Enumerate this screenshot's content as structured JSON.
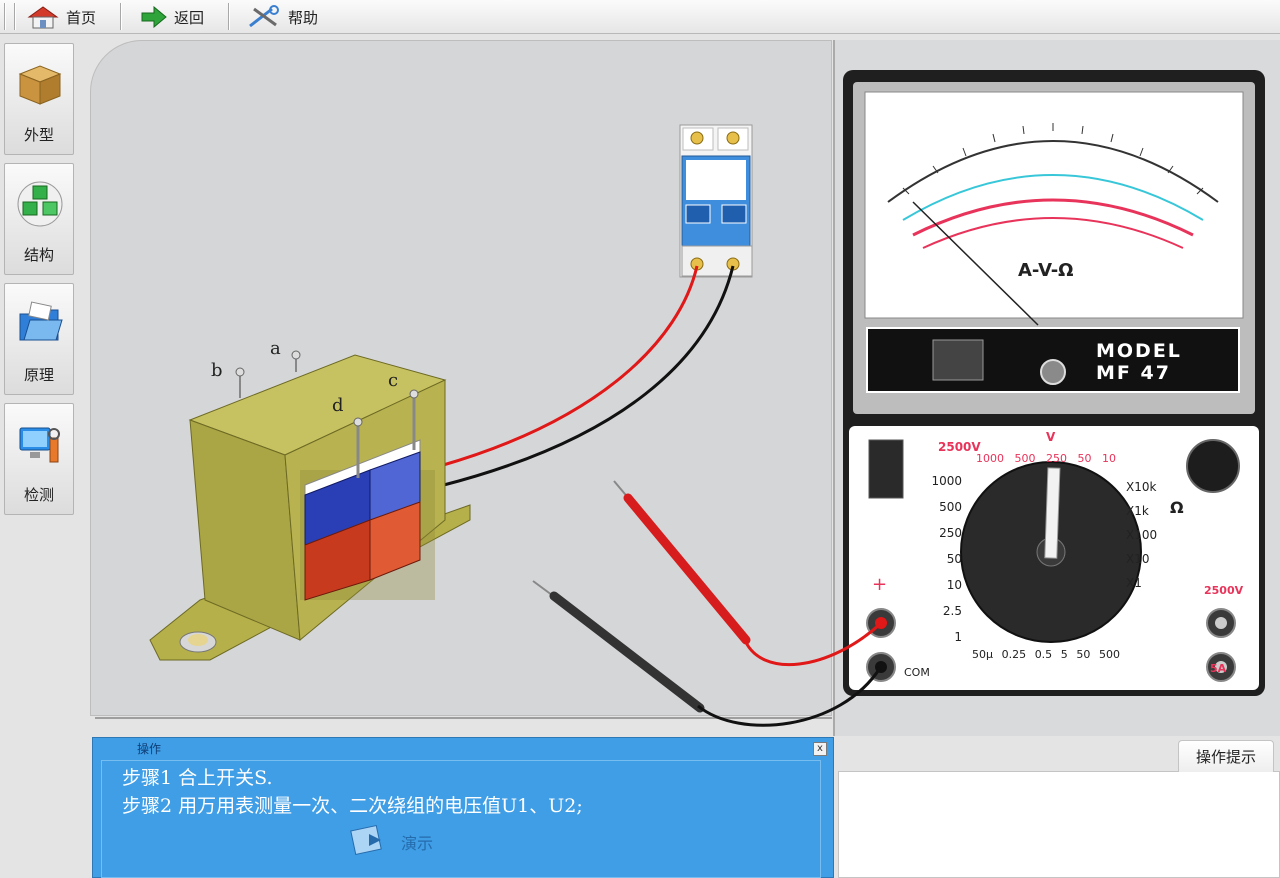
{
  "toolbar": {
    "home_label": "首页",
    "back_label": "返回",
    "help_label": "帮助"
  },
  "sidebar": {
    "items": [
      {
        "label": "外型"
      },
      {
        "label": "结构"
      },
      {
        "label": "原理"
      },
      {
        "label": "检测"
      }
    ]
  },
  "transformer": {
    "terminals": {
      "a": "a",
      "b": "b",
      "c": "c",
      "d": "d"
    }
  },
  "multimeter": {
    "model_line1": "MODEL",
    "model_line2": "MF 47",
    "scale_symbol": "A-V-Ω",
    "plus_label": "+",
    "com_label": "COM",
    "dial_labels_left": [
      "1000",
      "500",
      "250",
      "50",
      "10",
      "2.5",
      "1"
    ],
    "dial_labels_top": [
      "1000",
      "500",
      "250",
      "50",
      "10"
    ],
    "dial_labels_right": [
      "X10k",
      "X1k",
      "X100",
      "X10",
      "X1"
    ],
    "dial_labels_bottom": [
      "50μ",
      "0.25",
      "0.5",
      "5",
      "50",
      "500"
    ],
    "side_labels": {
      "v": "V",
      "ohm": "Ω",
      "top_red": "2500V",
      "right_red": "2500V",
      "right_bottom": "5A"
    },
    "colors": {
      "body": "#1f1f1f",
      "dial_face": "#ffffff",
      "red_scale": "#e8345a",
      "cyan_scale": "#38c7d8"
    }
  },
  "steps": {
    "tab_label": "操作",
    "step1": "步骤1  合上开关S.",
    "step2": "步骤2  用万用表测量一次、二次绕组的电压值U1、U2;",
    "demo_label": "演示",
    "close_label": "x"
  },
  "tips": {
    "tab_label": "操作提示"
  }
}
